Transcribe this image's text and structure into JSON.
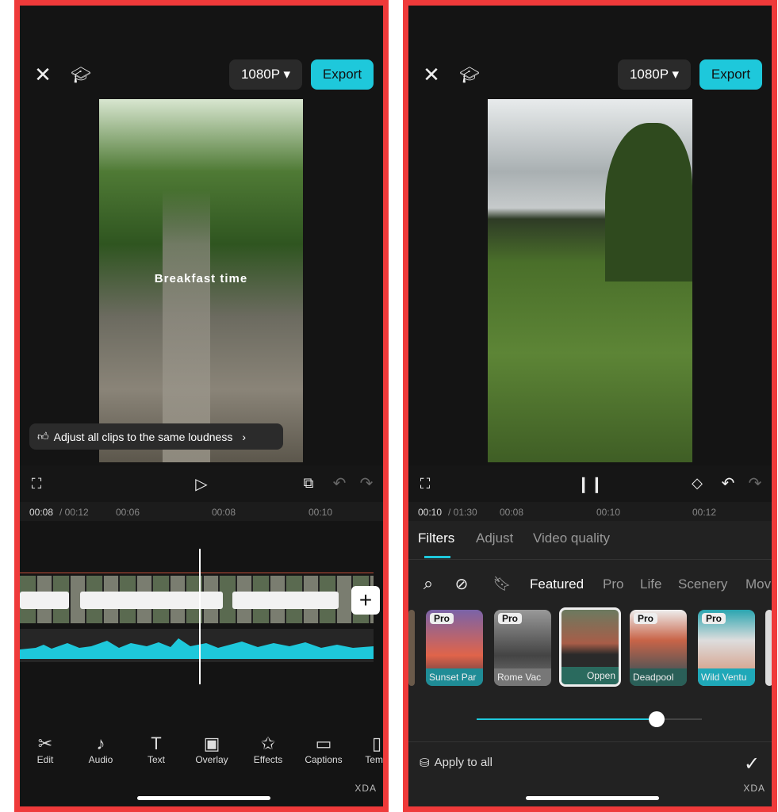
{
  "left": {
    "resolution": "1080P ▾",
    "export": "Export",
    "caption": "Breakfast time",
    "notice": "Adjust all clips to the same loudness",
    "time_current": "00:08",
    "time_total": "/ 00:12",
    "ruler": [
      "00:06",
      "00:08",
      "00:10"
    ],
    "tools": [
      {
        "icon": "scissors-icon",
        "glyph": "✂",
        "label": "Edit"
      },
      {
        "icon": "music-note-icon",
        "glyph": "♪",
        "label": "Audio"
      },
      {
        "icon": "text-icon",
        "glyph": "T",
        "label": "Text"
      },
      {
        "icon": "overlay-icon",
        "glyph": "▣",
        "label": "Overlay"
      },
      {
        "icon": "effects-star-icon",
        "glyph": "✩",
        "label": "Effects"
      },
      {
        "icon": "captions-icon",
        "glyph": "▭",
        "label": "Captions"
      },
      {
        "icon": "template-icon",
        "glyph": "▯",
        "label": "Temp"
      }
    ],
    "watermark": "XDA"
  },
  "right": {
    "resolution": "1080P ▾",
    "export": "Export",
    "time_current": "00:10",
    "time_total": "/ 01:30",
    "ruler": [
      "00:08",
      "00:10",
      "00:12"
    ],
    "tabs": [
      "Filters",
      "Adjust",
      "Video quality"
    ],
    "active_tab": "Filters",
    "categories": [
      "Featured",
      "Pro",
      "Life",
      "Scenery",
      "Mov"
    ],
    "filters": [
      {
        "name": "Sunset Par",
        "pro": "Pro"
      },
      {
        "name": "Rome Vac",
        "pro": "Pro"
      },
      {
        "name": "Oppen",
        "pro": ""
      },
      {
        "name": "Deadpool",
        "pro": "Pro"
      },
      {
        "name": "Wild Ventu",
        "pro": "Pro"
      }
    ],
    "selected_filter": "Oppen",
    "intensity_percent": 80,
    "apply_all": "Apply to all",
    "watermark": "XDA"
  },
  "colors": {
    "accent": "#1ec8db",
    "border": "#ef3a3a"
  }
}
